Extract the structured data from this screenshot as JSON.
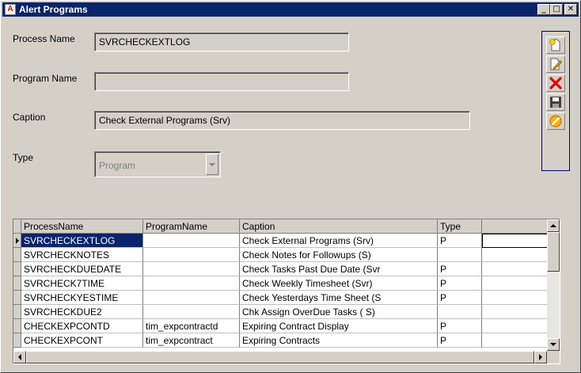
{
  "window": {
    "title": "Alert Programs",
    "app_icon": "app-icon",
    "controls": {
      "minimize": "_",
      "maximize": "□",
      "close": "✕"
    }
  },
  "form": {
    "process_name": {
      "label": "Process Name",
      "value": "SVRCHECKEXTLOG"
    },
    "program_name": {
      "label": "Program Name",
      "value": ""
    },
    "caption": {
      "label": "Caption",
      "value": "Check External Programs (Srv)"
    },
    "type": {
      "label": "Type",
      "value": "Program"
    }
  },
  "toolbar": {
    "buttons": [
      "new-record-icon",
      "edit-record-icon",
      "delete-record-icon",
      "save-icon",
      "cancel-icon"
    ]
  },
  "grid": {
    "columns": [
      "ProcessName",
      "ProgramName",
      "Caption",
      "Type",
      ""
    ],
    "rows": [
      [
        "SVRCHECKEXTLOG",
        "",
        "Check External Programs (Srv)",
        "P",
        ""
      ],
      [
        "SVRCHECKNOTES",
        "",
        "Check Notes for Followups (S)",
        "",
        ""
      ],
      [
        "SVRCHECKDUEDATE",
        "",
        "Check Tasks Past Due Date (Svr",
        "P",
        ""
      ],
      [
        "SVRCHECK7TIME",
        "",
        "Check Weekly Timesheet (Svr)",
        "P",
        ""
      ],
      [
        "SVRCHECKYESTIME",
        "",
        "Check Yesterdays Time Sheet (S",
        "P",
        ""
      ],
      [
        "SVRCHECKDUE2",
        "",
        "Chk Assign OverDue Tasks ( S)",
        "",
        ""
      ],
      [
        "CHECKEXPCONTD",
        "tim_expcontractd",
        "Expiring Contract Display",
        "P",
        ""
      ],
      [
        "CHECKEXPCONT",
        "tim_expcontract",
        "Expiring Contracts",
        "P",
        ""
      ]
    ],
    "selected_row": 0
  },
  "colors": {
    "titlebar": "#0a246a",
    "selection": "#0a246a",
    "face": "#d4d0c8"
  }
}
